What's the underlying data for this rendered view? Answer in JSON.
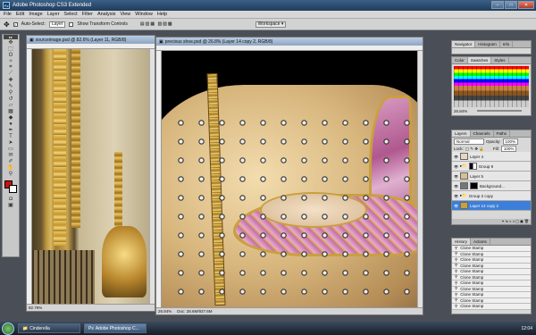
{
  "app": {
    "title": "Adobe Photoshop CS3 Extended",
    "icon": "Ps"
  },
  "window_buttons": {
    "min": "–",
    "max": "□",
    "close": "✕"
  },
  "menu": [
    "File",
    "Edit",
    "Image",
    "Layer",
    "Select",
    "Filter",
    "Analysis",
    "View",
    "Window",
    "Help"
  ],
  "options": {
    "auto_select_label": "Auto-Select:",
    "auto_select_value": "Layer",
    "transform_label": "Show Transform Controls",
    "workspace_label": "Workspace ▾"
  },
  "doc_left": {
    "title": "sourceimage.psd @ 82.6% (Layer 11, RGB/8)",
    "zoom": "82.79%"
  },
  "doc_right": {
    "title": "precious shoe.psd @ 26.8% (Layer 14 copy 2, RGB/8)",
    "zoom": "26.84%",
    "doc_info": "Doc: 28.6M/927.6M"
  },
  "nav_panel": {
    "tabs": [
      "Navigator",
      "Histogram",
      "Info"
    ],
    "zoom": "26.84%"
  },
  "swatch_panel": {
    "tabs": [
      "Color",
      "Swatches",
      "Styles"
    ]
  },
  "layers_panel": {
    "tabs": [
      "Layers",
      "Channels",
      "Paths"
    ],
    "blend": "Normal",
    "opacity_label": "Opacity:",
    "opacity": "100%",
    "lock_label": "Lock:",
    "fill_label": "Fill:",
    "fill": "100%",
    "layers": [
      {
        "name": "Layer 4"
      },
      {
        "name": "Group 9"
      },
      {
        "name": "Layer 5"
      },
      {
        "name": "Background..."
      },
      {
        "name": "Group 2 copy"
      },
      {
        "name": "Layer 14 copy 2"
      }
    ]
  },
  "history_panel": {
    "tabs": [
      "History",
      "Actions"
    ],
    "items": [
      "Clone Stamp",
      "Clone Stamp",
      "Clone Stamp",
      "Clone Stamp",
      "Clone Stamp",
      "Clone Stamp",
      "Clone Stamp",
      "Clone Stamp",
      "Clone Stamp",
      "Clone Stamp",
      "Clone Stamp"
    ]
  },
  "taskbar": {
    "items": [
      "Cinderella",
      "Adobe Photoshop C..."
    ],
    "clock": "12:04"
  },
  "colors": {
    "accent": "#3d7fd8",
    "foreground_swatch": "#cc1111",
    "background_swatch": "#ffffff"
  }
}
